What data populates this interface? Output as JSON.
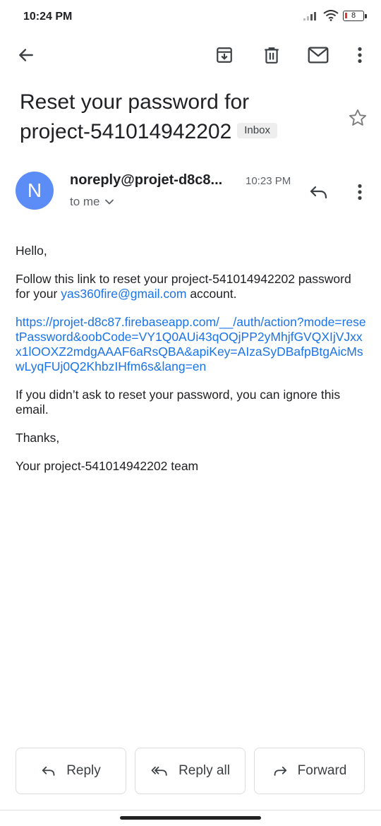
{
  "status": {
    "time": "10:24 PM",
    "battery_text": "8"
  },
  "subject": {
    "text": "Reset your password for project-541014942202",
    "label": "Inbox"
  },
  "message": {
    "avatar_letter": "N",
    "sender": "noreply@projet-d8c8...",
    "time": "10:23 PM",
    "recipient": "to me",
    "body": {
      "greeting": "Hello,",
      "line1_prefix": "Follow this link to reset your project-541014942202 password for your ",
      "email_link": "yas360fire@gmail.com",
      "line1_suffix": " account.",
      "reset_url": "https://projet-d8c87.firebaseapp.com/__/auth/action?mode=resetPassword&oobCode=VY1Q0AUi43qOQjPP2yMhjfGVQXIjVJxxx1lOOXZ2mdgAAAF6aRsQBA&apiKey=AIzaSyDBafpBtgAicMswLyqFUj0Q2KhbzIHfm6s&lang=en",
      "ignore_note": "If you didn’t ask to reset your password, you can ignore this email.",
      "thanks": "Thanks,",
      "signature": "Your project-541014942202 team"
    }
  },
  "actions": {
    "reply": "Reply",
    "reply_all": "Reply all",
    "forward": "Forward"
  },
  "icons": {
    "back": "arrow-left-icon",
    "archive": "archive-icon",
    "delete": "trash-icon",
    "mark_unread": "mail-icon",
    "more": "more-vert-icon",
    "star": "star-icon",
    "reply": "reply-icon",
    "reply_all": "reply-all-icon",
    "forward": "forward-icon"
  },
  "colors": {
    "accent_link": "#1a73e8",
    "avatar_bg": "#5c8df6",
    "battery_low": "#e53935"
  }
}
